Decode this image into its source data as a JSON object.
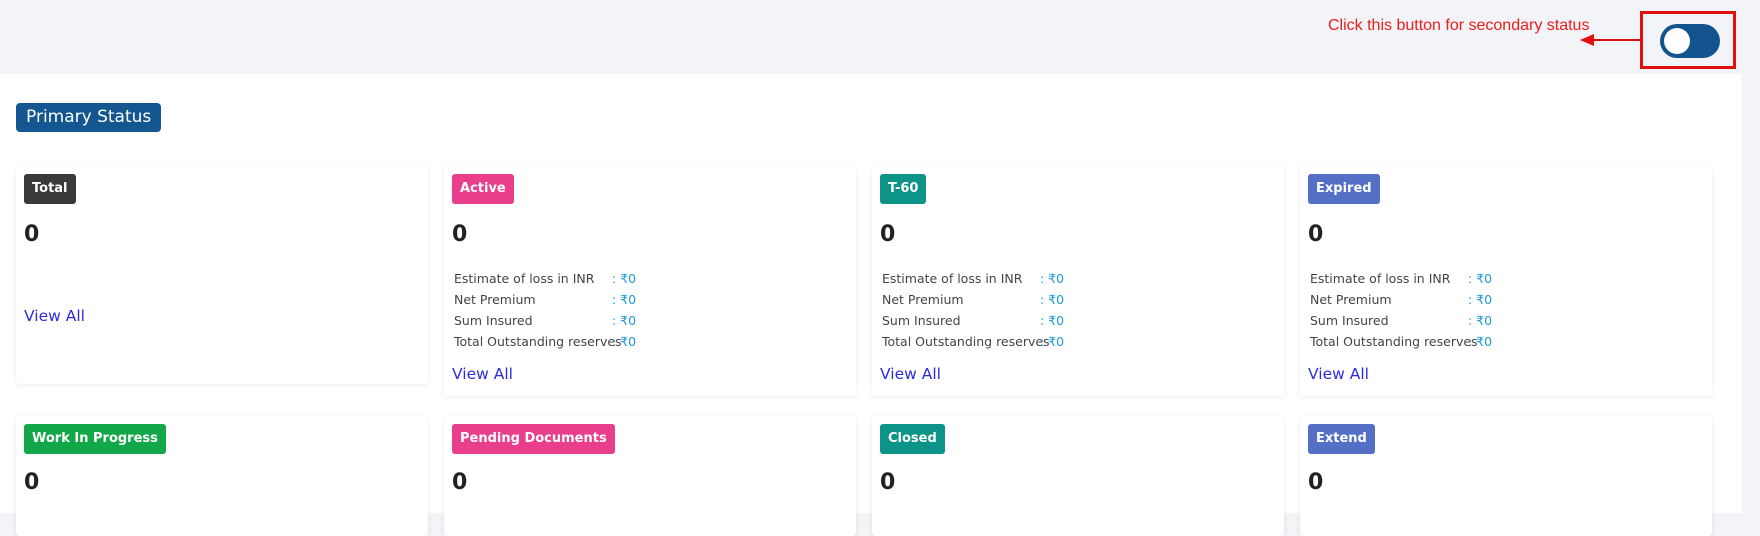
{
  "annotation": {
    "text": "Click this button for secondary status",
    "color": "#ee1c1c"
  },
  "toggle": {
    "state": "off",
    "color": "#13548f"
  },
  "section": {
    "title": "Primary Status"
  },
  "stat_labels": {
    "estimate": "Estimate of loss in INR",
    "premium": "Net Premium",
    "sum": "Sum Insured",
    "reserves": "Total Outstanding reserves"
  },
  "cards": [
    {
      "label": "Total",
      "count": "0",
      "color": "#3a3a3a",
      "view_all": "View All"
    },
    {
      "label": "Active",
      "count": "0",
      "color": "#e83e8c",
      "view_all": "View All",
      "estimate": ": ₹0",
      "premium": ": ₹0",
      "sum": ": ₹0",
      "reserves": ": ₹0"
    },
    {
      "label": "T-60",
      "count": "0",
      "color": "#0d9488",
      "view_all": "View All",
      "estimate": ": ₹0",
      "premium": ": ₹0",
      "sum": ": ₹0",
      "reserves": ": ₹0"
    },
    {
      "label": "Expired",
      "count": "0",
      "color": "#5470c6",
      "view_all": "View All",
      "estimate": ": ₹0",
      "premium": ": ₹0",
      "sum": ": ₹0",
      "reserves": ": ₹0"
    },
    {
      "label": "Work In Progress",
      "count": "0",
      "color": "#12a84a"
    },
    {
      "label": "Pending Documents",
      "count": "0",
      "color": "#e83e8c"
    },
    {
      "label": "Closed",
      "count": "0",
      "color": "#0d9488"
    },
    {
      "label": "Extend",
      "count": "0",
      "color": "#5470c6"
    }
  ]
}
